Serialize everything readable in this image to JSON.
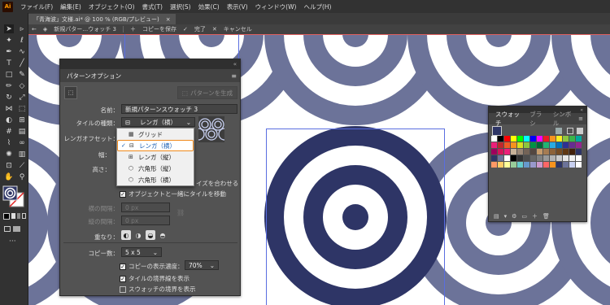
{
  "app": {
    "logo": "Ai"
  },
  "menu": [
    "ファイル(F)",
    "編集(E)",
    "オブジェクト(O)",
    "書式(T)",
    "選択(S)",
    "効果(C)",
    "表示(V)",
    "ウィンドウ(W)",
    "ヘルプ(H)"
  ],
  "document_tab": {
    "title": "「青海波」文様.ai* @ 100 % (RGB/プレビュー)",
    "close": "×"
  },
  "pattern_bar": {
    "name": "新規パター…ウォッチ 3",
    "save_copy": "コピーを保存",
    "done": "完了",
    "cancel": "キャンセル"
  },
  "pattern_options": {
    "title": "パターンオプション",
    "make_pattern_button": "パターンを生成",
    "name_label": "名前：",
    "name_value": "新規パターンスウォッチ 3",
    "tile_type_label": "タイルの種類：",
    "tile_type_value": "レンガ（横）",
    "brick_offset_label": "レンガオフセット：",
    "width_label": "幅：",
    "height_label": "高さ：",
    "fit_size_text": "イズを合わせる",
    "move_tile_label": "オブジェクトと一緒にタイルを移動",
    "h_spacing_label": "横の間隔：",
    "v_spacing_label": "縦の間隔：",
    "h_spacing_value": "0 px",
    "v_spacing_value": "0 px",
    "overlap_label": "重なり：",
    "copies_label": "コピー数：",
    "copies_value": "5 x 5",
    "dim_copies_label": "コピーの表示濃度：",
    "dim_copies_value": "70%",
    "show_tile_edge_label": "タイルの境界線を表示",
    "show_swatch_bounds_label": "スウォッチの境界を表示",
    "tile_type_options": [
      {
        "label": "グリッド",
        "selected": false
      },
      {
        "label": "レンガ（横）",
        "selected": true
      },
      {
        "label": "レンガ（縦）",
        "selected": false
      },
      {
        "label": "六角形（縦）",
        "selected": false
      },
      {
        "label": "六角形（横）",
        "selected": false
      }
    ]
  },
  "swatches_panel": {
    "tabs": [
      "スウォッチ",
      "ブラシ",
      "シンボル"
    ]
  },
  "colors": {
    "wave_dark": "#2e3566",
    "wave_light": "#6c7399",
    "accent_orange": "#f08a1c",
    "selection_blue": "#1a5fb4"
  }
}
